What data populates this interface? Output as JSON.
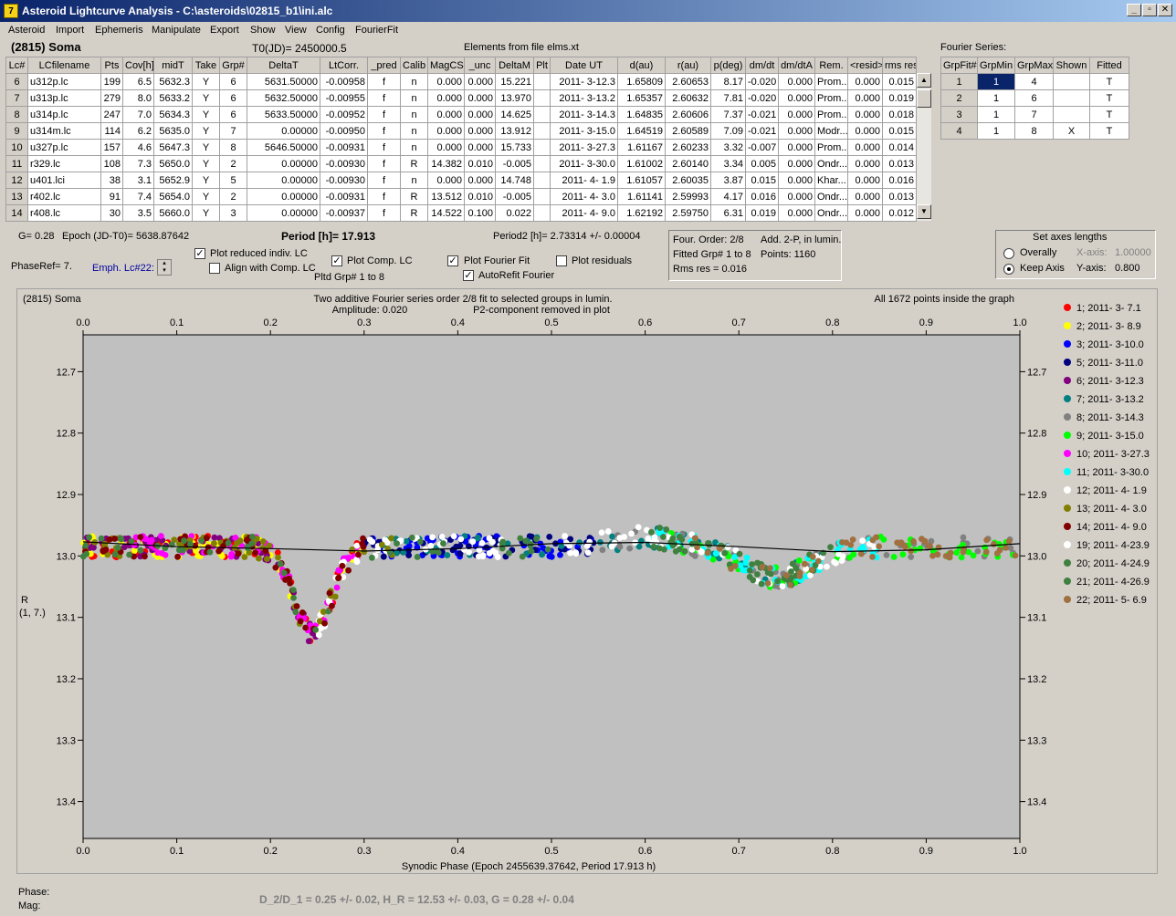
{
  "window": {
    "title": "Asteroid Lightcurve Analysis - C:\\asteroids\\02815_b1\\ini.alc",
    "icon_glyph": "7"
  },
  "window_buttons": {
    "minimize": "_",
    "maximize": "▫",
    "close": "✕"
  },
  "menu": [
    "Asteroid",
    "Import",
    "Ephemeris",
    "Manipulate",
    "Export",
    "Show",
    "View",
    "Config",
    "FourierFit"
  ],
  "header": {
    "asteroid": "(2815) Soma",
    "t0": "T0(JD)= 2450000.5",
    "elements": "Elements from file elms.xt"
  },
  "lc_table": {
    "columns": [
      "Lc#",
      "LCfilename",
      "Pts",
      "Cov[h]",
      "midT",
      "Take",
      "Grp#",
      "DeltaT",
      "LtCorr.",
      "_pred",
      "Calib",
      "MagCS",
      "_unc",
      "DeltaM",
      "Plt",
      "Date UT",
      "d(au)",
      "r(au)",
      "p(deg)",
      "dm/dt",
      "dm/dtA",
      "Rem.",
      "<resid>",
      "rms res"
    ],
    "rows": [
      [
        "6",
        "u312p.lc",
        "199",
        "6.5",
        "5632.3",
        "Y",
        "6",
        "5631.50000",
        "-0.00958",
        "f",
        "n",
        "0.000",
        "0.000",
        "15.221",
        "",
        "2011- 3-12.3",
        "1.65809",
        "2.60653",
        "8.17",
        "-0.020",
        "0.000",
        "Prom...",
        "0.000",
        "0.015"
      ],
      [
        "7",
        "u313p.lc",
        "279",
        "8.0",
        "5633.2",
        "Y",
        "6",
        "5632.50000",
        "-0.00955",
        "f",
        "n",
        "0.000",
        "0.000",
        "13.970",
        "",
        "2011- 3-13.2",
        "1.65357",
        "2.60632",
        "7.81",
        "-0.020",
        "0.000",
        "Prom...",
        "0.000",
        "0.019"
      ],
      [
        "8",
        "u314p.lc",
        "247",
        "7.0",
        "5634.3",
        "Y",
        "6",
        "5633.50000",
        "-0.00952",
        "f",
        "n",
        "0.000",
        "0.000",
        "14.625",
        "",
        "2011- 3-14.3",
        "1.64835",
        "2.60606",
        "7.37",
        "-0.021",
        "0.000",
        "Prom...",
        "0.000",
        "0.018"
      ],
      [
        "9",
        "u314m.lc",
        "114",
        "6.2",
        "5635.0",
        "Y",
        "7",
        "0.00000",
        "-0.00950",
        "f",
        "n",
        "0.000",
        "0.000",
        "13.912",
        "",
        "2011- 3-15.0",
        "1.64519",
        "2.60589",
        "7.09",
        "-0.021",
        "0.000",
        "Modr...",
        "0.000",
        "0.015"
      ],
      [
        "10",
        "u327p.lc",
        "157",
        "4.6",
        "5647.3",
        "Y",
        "8",
        "5646.50000",
        "-0.00931",
        "f",
        "n",
        "0.000",
        "0.000",
        "15.733",
        "",
        "2011- 3-27.3",
        "1.61167",
        "2.60233",
        "3.32",
        "-0.007",
        "0.000",
        "Prom...",
        "0.000",
        "0.014"
      ],
      [
        "11",
        "r329.lc",
        "108",
        "7.3",
        "5650.0",
        "Y",
        "2",
        "0.00000",
        "-0.00930",
        "f",
        "R",
        "14.382",
        "0.010",
        "-0.005",
        "",
        "2011- 3-30.0",
        "1.61002",
        "2.60140",
        "3.34",
        "0.005",
        "0.000",
        "Ondr...",
        "0.000",
        "0.013"
      ],
      [
        "12",
        "u401.lci",
        "38",
        "3.1",
        "5652.9",
        "Y",
        "5",
        "0.00000",
        "-0.00930",
        "f",
        "n",
        "0.000",
        "0.000",
        "14.748",
        "",
        "2011- 4- 1.9",
        "1.61057",
        "2.60035",
        "3.87",
        "0.015",
        "0.000",
        "Khar...",
        "0.000",
        "0.016"
      ],
      [
        "13",
        "r402.lc",
        "91",
        "7.4",
        "5654.0",
        "Y",
        "2",
        "0.00000",
        "-0.00931",
        "f",
        "R",
        "13.512",
        "0.010",
        "-0.005",
        "",
        "2011- 4- 3.0",
        "1.61141",
        "2.59993",
        "4.17",
        "0.016",
        "0.000",
        "Ondr...",
        "0.000",
        "0.013"
      ],
      [
        "14",
        "r408.lc",
        "30",
        "3.5",
        "5660.0",
        "Y",
        "3",
        "0.00000",
        "-0.00937",
        "f",
        "R",
        "14.522",
        "0.100",
        "0.022",
        "",
        "2011- 4- 9.0",
        "1.62192",
        "2.59750",
        "6.31",
        "0.019",
        "0.000",
        "Ondr...",
        "0.000",
        "0.012"
      ]
    ]
  },
  "fourier_series": {
    "label": "Fourier Series:",
    "columns": [
      "GrpFit#",
      "GrpMin",
      "GrpMax",
      "Shown",
      "Fitted"
    ],
    "rows": [
      [
        "1",
        "1",
        "4",
        "",
        "T"
      ],
      [
        "2",
        "1",
        "6",
        "",
        "T"
      ],
      [
        "3",
        "1",
        "7",
        "",
        "T"
      ],
      [
        "4",
        "1",
        "8",
        "X",
        "T"
      ]
    ]
  },
  "controls": {
    "g": "G= 0.28",
    "epoch": "Epoch (JD-T0)= 5638.87642",
    "period": "Period [h]= 17.913",
    "period2": "Period2 [h]= 2.73314 +/- 0.00004",
    "phaseref": "PhaseRef= 7.",
    "emph": "Emph. Lc#22:",
    "plot_reduced": "Plot reduced indiv. LC",
    "align_comp": "Align with Comp. LC",
    "plot_comp": "Plot Comp. LC",
    "pltd_grp": "Pltd Grp#  1   to    8",
    "plot_fourier": "Plot Fourier Fit",
    "autorefit": "AutoRefit Fourier",
    "plot_resid": "Plot residuals"
  },
  "fit_info": {
    "line1": "Four. Order:  2/8",
    "line1b": "Add. 2-P, in lumin.",
    "line2": "Fitted Grp# 1 to 8",
    "line2b": "Points: 1160",
    "line3": "Rms res      = 0.016"
  },
  "axes_panel": {
    "title": "Set axes lengths",
    "overally": "Overally",
    "keep": "Keep Axis",
    "xaxis": "X-axis:",
    "xval": "1.00000",
    "yaxis": "Y-axis:",
    "yval": "0.800"
  },
  "plot": {
    "asteroid": "(2815) Soma",
    "title1": "Two additive Fourier series order 2/8 fit to selected groups in lumin.",
    "title2a": "Amplitude: 0.020",
    "title2b": "P2-component removed in plot",
    "points_note": "All 1672 points inside the graph",
    "xlabel": "Synodic Phase (Epoch 2455639.37642, Period 17.913 h)",
    "ylabel1": "R",
    "ylabel2": "(1, 7.)"
  },
  "chart_data": {
    "type": "scatter",
    "x_ticks": [
      0.0,
      0.1,
      0.2,
      0.3,
      0.4,
      0.5,
      0.6,
      0.7,
      0.8,
      0.9,
      1.0
    ],
    "y_ticks": [
      12.7,
      12.8,
      12.9,
      13.0,
      13.1,
      13.2,
      13.3,
      13.4
    ],
    "xlim": [
      0.0,
      1.0
    ],
    "ylim": [
      13.46,
      12.64
    ],
    "y_inverted": true,
    "fit_curve": {
      "x": [
        0.0,
        0.1,
        0.2,
        0.3,
        0.4,
        0.5,
        0.6,
        0.7,
        0.8,
        0.9,
        1.0
      ],
      "y": [
        12.977,
        12.985,
        12.988,
        12.992,
        12.988,
        12.98,
        12.978,
        12.985,
        12.993,
        12.99,
        12.98
      ]
    },
    "series": [
      {
        "name": "1; 2011- 3- 7.1",
        "color": "#ff0000"
      },
      {
        "name": "2; 2011- 3- 8.9",
        "color": "#ffff00"
      },
      {
        "name": "3; 2011- 3-10.0",
        "color": "#0000ff"
      },
      {
        "name": "5; 2011- 3-11.0",
        "color": "#000080"
      },
      {
        "name": "6; 2011- 3-12.3",
        "color": "#800080"
      },
      {
        "name": "7; 2011- 3-13.2",
        "color": "#008080"
      },
      {
        "name": "8; 2011- 3-14.3",
        "color": "#808080"
      },
      {
        "name": "9; 2011- 3-15.0",
        "color": "#00ff00"
      },
      {
        "name": "10; 2011- 3-27.3",
        "color": "#ff00ff"
      },
      {
        "name": "11; 2011- 3-30.0",
        "color": "#00ffff"
      },
      {
        "name": "12; 2011- 4- 1.9",
        "color": "#ffffff"
      },
      {
        "name": "13; 2011- 4- 3.0",
        "color": "#808000"
      },
      {
        "name": "14; 2011- 4- 9.0",
        "color": "#800000"
      },
      {
        "name": "19; 2011- 4-23.9",
        "color": "#ffffff"
      },
      {
        "name": "20; 2011- 4-24.9",
        "color": "#408040"
      },
      {
        "name": "21; 2011- 4-26.9",
        "color": "#408040"
      },
      {
        "name": "22; 2011- 5- 6.9",
        "color": "#a07040"
      }
    ]
  },
  "footer": {
    "phase": "Phase:",
    "mag": "Mag:",
    "result": "D_2/D_1 = 0.25 +/- 0.02, H_R = 12.53 +/- 0.03, G = 0.28 +/- 0.04"
  }
}
